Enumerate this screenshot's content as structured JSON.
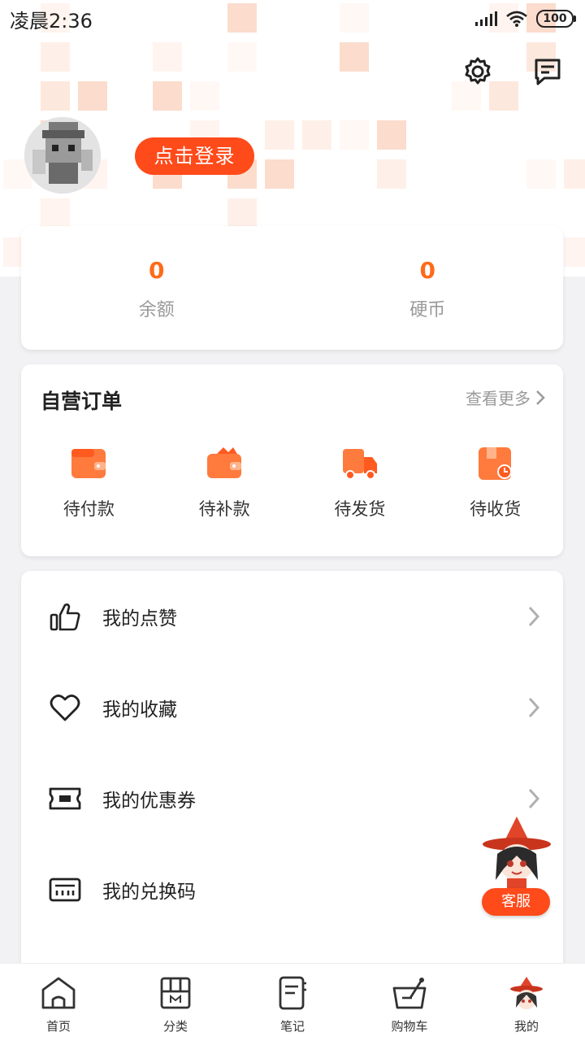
{
  "status_bar": {
    "time": "凌晨2:36",
    "battery": "100"
  },
  "header": {
    "login_button": "点击登录"
  },
  "balance": {
    "items": [
      {
        "value": "0",
        "label": "余额"
      },
      {
        "value": "0",
        "label": "硬币"
      }
    ]
  },
  "orders": {
    "title": "自营订单",
    "more": "查看更多",
    "items": [
      {
        "label": "待付款",
        "icon": "wallet-icon"
      },
      {
        "label": "待补款",
        "icon": "wallet-open-icon"
      },
      {
        "label": "待发货",
        "icon": "truck-icon"
      },
      {
        "label": "待收货",
        "icon": "package-icon"
      }
    ]
  },
  "menu": {
    "items": [
      {
        "label": "我的点赞",
        "icon": "thumbs-up-icon"
      },
      {
        "label": "我的收藏",
        "icon": "heart-icon"
      },
      {
        "label": "我的优惠券",
        "icon": "coupon-icon"
      },
      {
        "label": "我的兑换码",
        "icon": "redeem-code-icon"
      }
    ]
  },
  "floating": {
    "customer_service": "客服"
  },
  "tabbar": {
    "items": [
      {
        "label": "首页",
        "icon": "home-icon"
      },
      {
        "label": "分类",
        "icon": "category-icon"
      },
      {
        "label": "笔记",
        "icon": "notes-icon"
      },
      {
        "label": "购物车",
        "icon": "cart-icon"
      },
      {
        "label": "我的",
        "icon": "profile-icon"
      }
    ],
    "active_index": 4
  },
  "colors": {
    "accent": "#ff4a1a",
    "accent_light": "#ff7a3d",
    "value": "#ff6a1a"
  }
}
